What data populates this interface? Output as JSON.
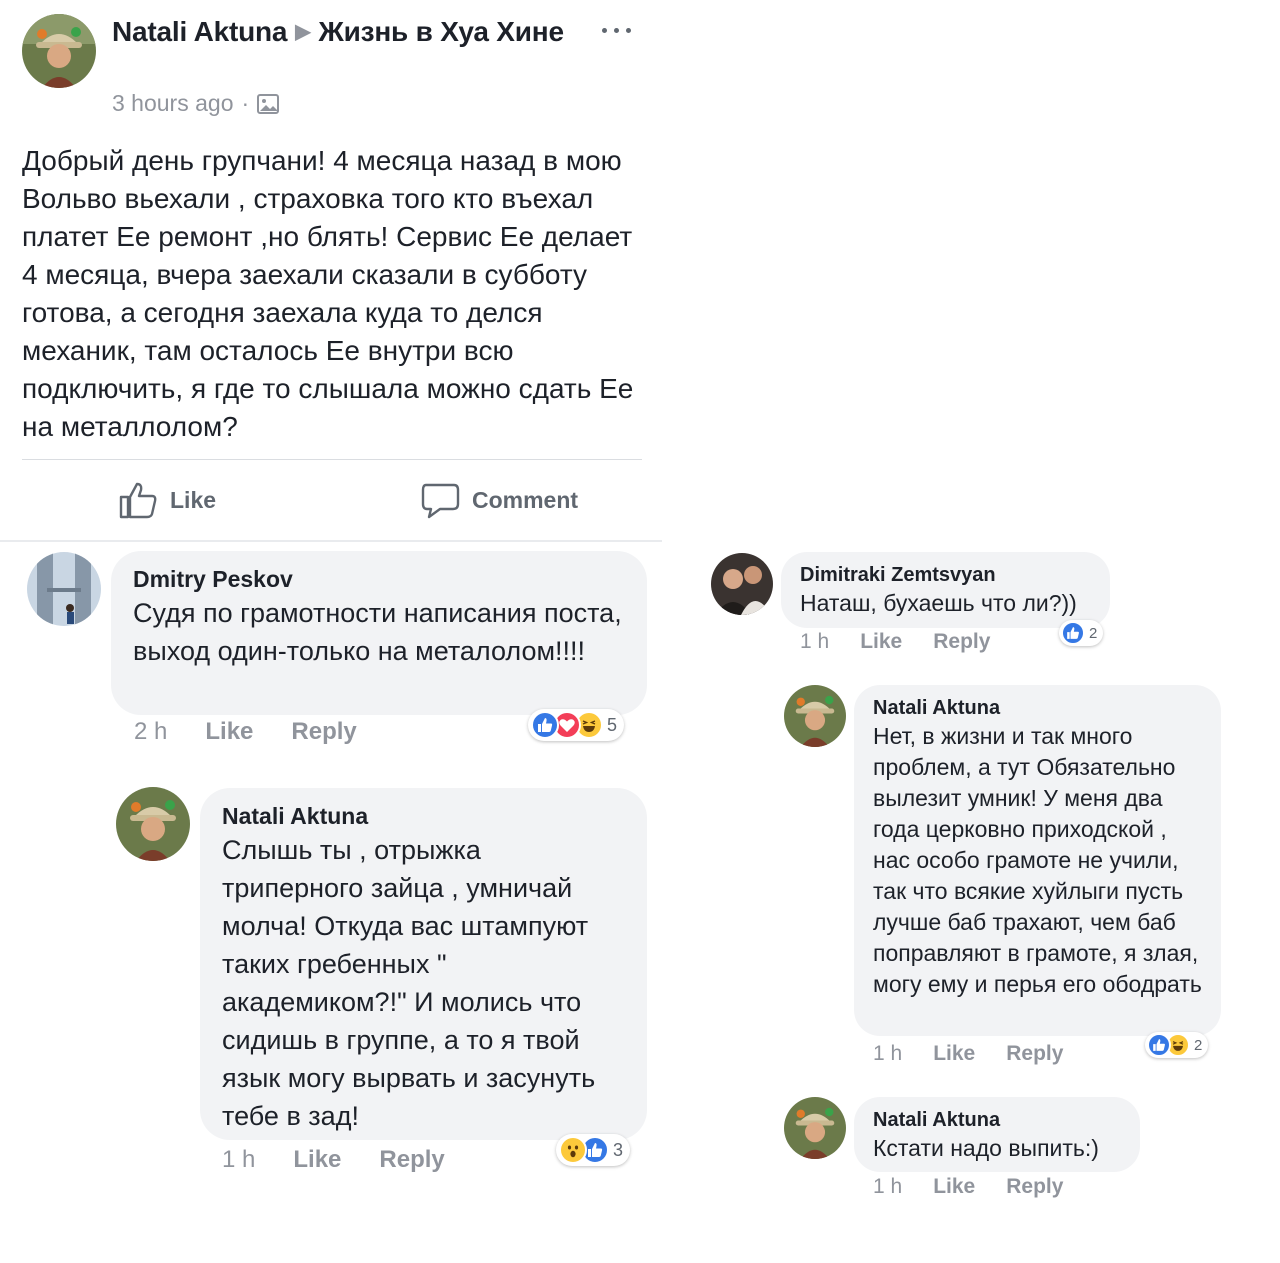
{
  "post": {
    "author": "Natali Aktuna",
    "group": "Жизнь в Хуа Хине",
    "time": "3 hours ago",
    "text": "Добрый день групчани! 4 месяца назад в мою Вольво вьехали , страховка того кто въехал платет Ее ремонт ,но блять! Сервис Ее делает 4 месяца, вчера заехали сказали в субботу готова, а сегодня заехала куда то делся механик, там осталось Ее внутри всю подключить, я где то слышала можно сдать Ее на металлолом?",
    "like_label": "Like",
    "comment_label": "Comment"
  },
  "comments_left": [
    {
      "author": "Dmitry Peskov",
      "text": "Судя по грамотности написания поста, выход один-только на металолом!!!!",
      "time": "2 h",
      "like": "Like",
      "reply": "Reply",
      "reaction_count": "5",
      "reactions": [
        "like-icon",
        "love-icon",
        "haha-icon"
      ]
    },
    {
      "author": "Natali Aktuna",
      "text": "Слышь ты , отрыжка триперного зайца , умничай молча! Откуда вас штампуют таких гребенных \" академиком?!\" И молись что сидишь в группе, а то я твой язык могу вырвать и засунуть тебе в зад!",
      "time": "1 h",
      "like": "Like",
      "reply": "Reply",
      "reaction_count": "3",
      "reactions": [
        "wow-icon",
        "like-icon"
      ]
    }
  ],
  "comments_right": [
    {
      "author": "Dimitraki Zemtsvyan",
      "text": "Наташ, бухаешь что ли?))",
      "time": "1 h",
      "like": "Like",
      "reply": "Reply",
      "reaction_count": "2",
      "reactions": [
        "like-icon"
      ]
    },
    {
      "author": "Natali Aktuna",
      "text": "Нет, в жизни и так много проблем, а тут Обязательно вылезит умник! У меня два года церковно приходской , нас особо грамоте не учили, так что всякие хуйлыги пусть лучше баб трахают, чем баб поправляют в грамоте, я злая, могу ему и перья его ободрать",
      "time": "1 h",
      "like": "Like",
      "reply": "Reply",
      "reaction_count": "2",
      "reactions": [
        "like-icon",
        "haha-icon"
      ]
    },
    {
      "author": "Natali Aktuna",
      "text": "Кстати надо выпить:)",
      "time": "1 h",
      "like": "Like",
      "reply": "Reply"
    }
  ],
  "colors": {
    "text": "#1d2129",
    "meta": "#90949c",
    "bubble": "#f2f3f5",
    "like_blue": "#3578e5",
    "love_red": "#f33e58",
    "haha_yellow": "#fcc93b"
  }
}
